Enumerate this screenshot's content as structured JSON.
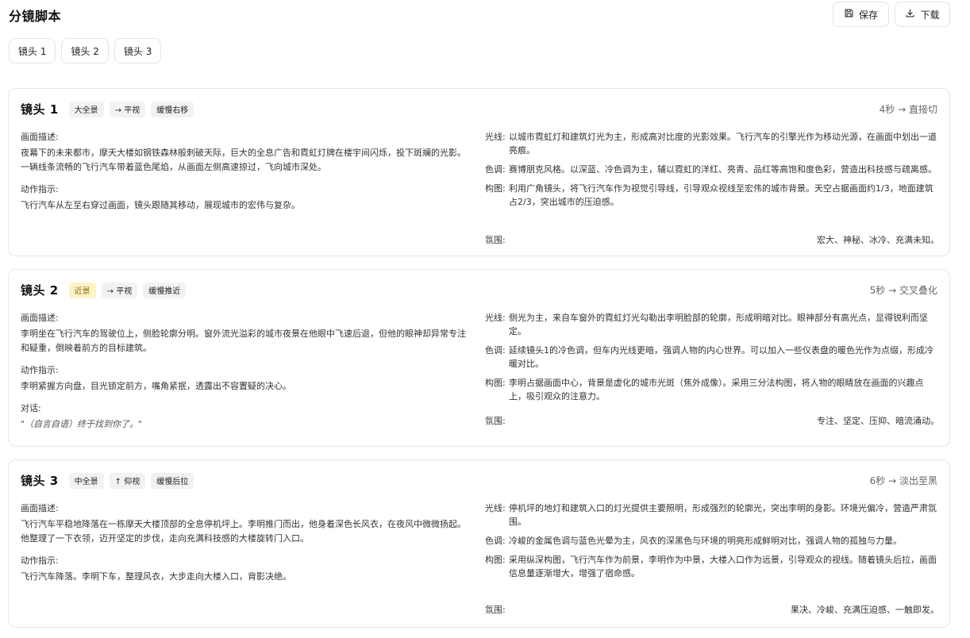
{
  "page": {
    "title": "分镜脚本"
  },
  "toolbar": {
    "save_label": "保存",
    "download_label": "下载"
  },
  "tabs": [
    {
      "label": "镜头 1"
    },
    {
      "label": "镜头 2"
    },
    {
      "label": "镜头 3"
    }
  ],
  "labels": {
    "description": "画面描述:",
    "action": "动作指示:",
    "dialogue": "对话:",
    "light": "光线:",
    "color": "色调:",
    "composition": "构图:",
    "mood": "氛围:"
  },
  "shots": [
    {
      "title": "镜头 1",
      "shot_size": "大全景",
      "angle": "→ 平视",
      "movement": "缓慢右移",
      "duration": "4秒 → 直接切",
      "description": "夜幕下的未来都市，摩天大楼如钢铁森林般刺破天际，巨大的全息广告和霓虹灯牌在楼宇间闪烁，投下斑斓的光影。一辆线条流畅的飞行汽车带着蓝色尾焰，从画面左侧高速掠过，飞向城市深处。",
      "action": "飞行汽车从左至右穿过画面，镜头跟随其移动，展现城市的宏伟与复杂。",
      "light": "以城市霓虹灯和建筑灯光为主，形成高对比度的光影效果。飞行汽车的引擎光作为移动光源，在画面中划出一道亮痕。",
      "color": "赛博朋克风格。以深蓝、冷色调为主，辅以霓虹的洋红、亮青、品红等高饱和度色彩，营造出科技感与疏离感。",
      "composition": "利用广角镜头，将飞行汽车作为视觉引导线，引导观众视线至宏伟的城市背景。天空占据画面约1/3，地面建筑占2/3，突出城市的压迫感。",
      "mood": "宏大、神秘、冰冷、充满未知。"
    },
    {
      "title": "镜头 2",
      "shot_size": "近景",
      "angle": "→ 平视",
      "movement": "缓慢推近",
      "duration": "5秒 → 交叉叠化",
      "description": "李明坐在飞行汽车的驾驶位上，侧脸轮廓分明。窗外流光溢彩的城市夜景在他眼中飞速后退，但他的眼神却异常专注和疑重，倒映着前方的目标建筑。",
      "action": "李明紧握方向盘，目光锁定前方，嘴角紧抿，透露出不容置疑的决心。",
      "dialogue": "\"（自言自语）终于找到你了。\"",
      "light": "侧光为主，来自车窗外的霓虹灯光勾勒出李明脸部的轮廓，形成明暗对比。眼神部分有高光点，显得锐利而坚定。",
      "color": "延续镜头1的冷色调，但车内光线更暗，强调人物的内心世界。可以加入一些仪表盘的暖色光作为点缀，形成冷暖对比。",
      "composition": "李明占据画面中心，背景是虚化的城市光斑（焦外成像）。采用三分法构图，将人物的眼睛放在画面的兴趣点上，吸引观众的注意力。",
      "mood": "专注、坚定、压抑、暗流涌动。"
    },
    {
      "title": "镜头 3",
      "shot_size": "中全景",
      "angle": "↑ 仰视",
      "movement": "缓慢后拉",
      "duration": "6秒 → 淡出至黑",
      "description": "飞行汽车平稳地降落在一栋摩天大楼顶部的全息停机坪上。李明推门而出，他身着深色长风衣，在夜风中微微扬起。他整理了一下衣领，迈开坚定的步伐，走向充满科技感的大楼旋转门入口。",
      "action": "飞行汽车降落。李明下车，整理风衣，大步走向大楼入口，背影决绝。",
      "light": "停机坪的地灯和建筑入口的灯光提供主要照明，形成强烈的轮廓光，突出李明的身影。环境光偏冷，营造严肃氛围。",
      "color": "冷峻的金属色调与蓝色光晕为主，风衣的深黑色与环境的明亮形成鲜明对比，强调人物的孤独与力量。",
      "composition": "采用纵深构图，飞行汽车作为前景，李明作为中景，大楼入口作为远景，引导观众的视线。随着镜头后拉，画面信息量逐渐增大，增强了宿命感。",
      "mood": "果决、冷峻、充满压迫感、一触即发。"
    }
  ]
}
